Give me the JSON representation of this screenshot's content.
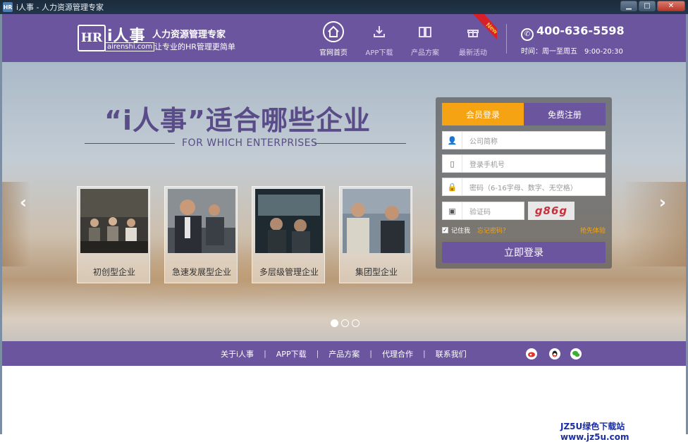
{
  "window": {
    "title": "i人事 - 人力资源管理专家"
  },
  "header": {
    "logo_mark": "HR",
    "brand": "i人事",
    "domain": "airenshi.com",
    "tagline": "人力资源管理专家",
    "subtitle": "让专业的HR管理更简单",
    "nav": [
      {
        "label": "官网首页",
        "icon": "home-icon"
      },
      {
        "label": "APP下载",
        "icon": "download-icon"
      },
      {
        "label": "产品方案",
        "icon": "book-icon"
      },
      {
        "label": "最新活动",
        "icon": "gift-icon"
      }
    ],
    "new_badge": "New",
    "phone": "400-636-5598",
    "hours_label": "时间：周一至周五",
    "hours_value": "9:00-20:30"
  },
  "banner": {
    "title": "“i人事”适合哪些企业",
    "subtitle": "FOR WHICH ENTERPRISES",
    "cards": [
      {
        "label": "初创型企业"
      },
      {
        "label": "急速发展型企业"
      },
      {
        "label": "多层级管理企业"
      },
      {
        "label": "集团型企业"
      }
    ],
    "slide_count": 3,
    "active_slide": 1
  },
  "login": {
    "tab_login": "会员登录",
    "tab_register": "免费注册",
    "company_placeholder": "公司简称",
    "phone_placeholder": "登录手机号",
    "password_placeholder": "密码（6-16字母、数字、无空格）",
    "captcha_placeholder": "验证码",
    "captcha_text": "g86g",
    "remember_label": "记住我",
    "forgot_label": "忘记密码？",
    "trial_label": "抢先体验",
    "submit_label": "立即登录"
  },
  "footer": {
    "links": [
      "关于i人事",
      "APP下载",
      "产品方案",
      "代理合作",
      "联系我们"
    ],
    "social": [
      "weibo-icon",
      "qq-icon",
      "wechat-icon"
    ]
  },
  "watermark": "JZ5U绿色下载站www.jz5u.com"
}
